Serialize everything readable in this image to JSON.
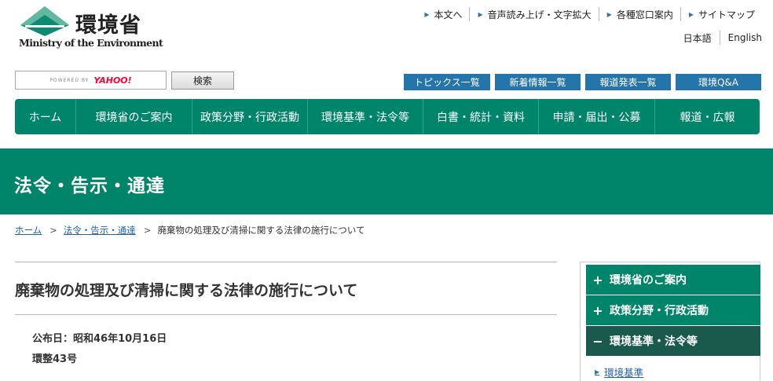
{
  "header": {
    "logo_jp": "環境省",
    "logo_en": "Ministry of the Environment",
    "util_links": [
      "本文へ",
      "音声読み上げ・文字拡大",
      "各種窓口案内",
      "サイトマップ"
    ],
    "lang_links": [
      "日本語",
      "English"
    ]
  },
  "search": {
    "powered_by": "POWERED BY",
    "provider": "YAHOO!",
    "button_label": "検索"
  },
  "quick_links": [
    "トピックス一覧",
    "新着情報一覧",
    "報道発表一覧",
    "環境Q&A"
  ],
  "gnav": [
    "ホーム",
    "環境省のご案内",
    "政策分野・行政活動",
    "環境基準・法令等",
    "白書・統計・資料",
    "申請・届出・公募",
    "報道・広報"
  ],
  "band_title": "法令・告示・通達",
  "breadcrumb": {
    "home": "ホーム",
    "sep": ">",
    "section": "法令・告示・通達",
    "current": "廃棄物の処理及び清掃に関する法律の施行について"
  },
  "main": {
    "title": "廃棄物の処理及び清掃に関する法律の施行について",
    "published": "公布日：昭和46年10月16日",
    "number": "環整43号"
  },
  "side_nav": {
    "items": [
      {
        "icon": "+",
        "label": "環境省のご案内"
      },
      {
        "icon": "+",
        "label": "政策分野・行政活動"
      },
      {
        "icon": "−",
        "label": "環境基準・法令等"
      }
    ],
    "sub_link": "環境基準"
  },
  "colors": {
    "brand_green": "#00856b",
    "dark_green": "#1a5a4c",
    "quick_blue": "#2475aa",
    "link_blue": "#2261a8"
  }
}
